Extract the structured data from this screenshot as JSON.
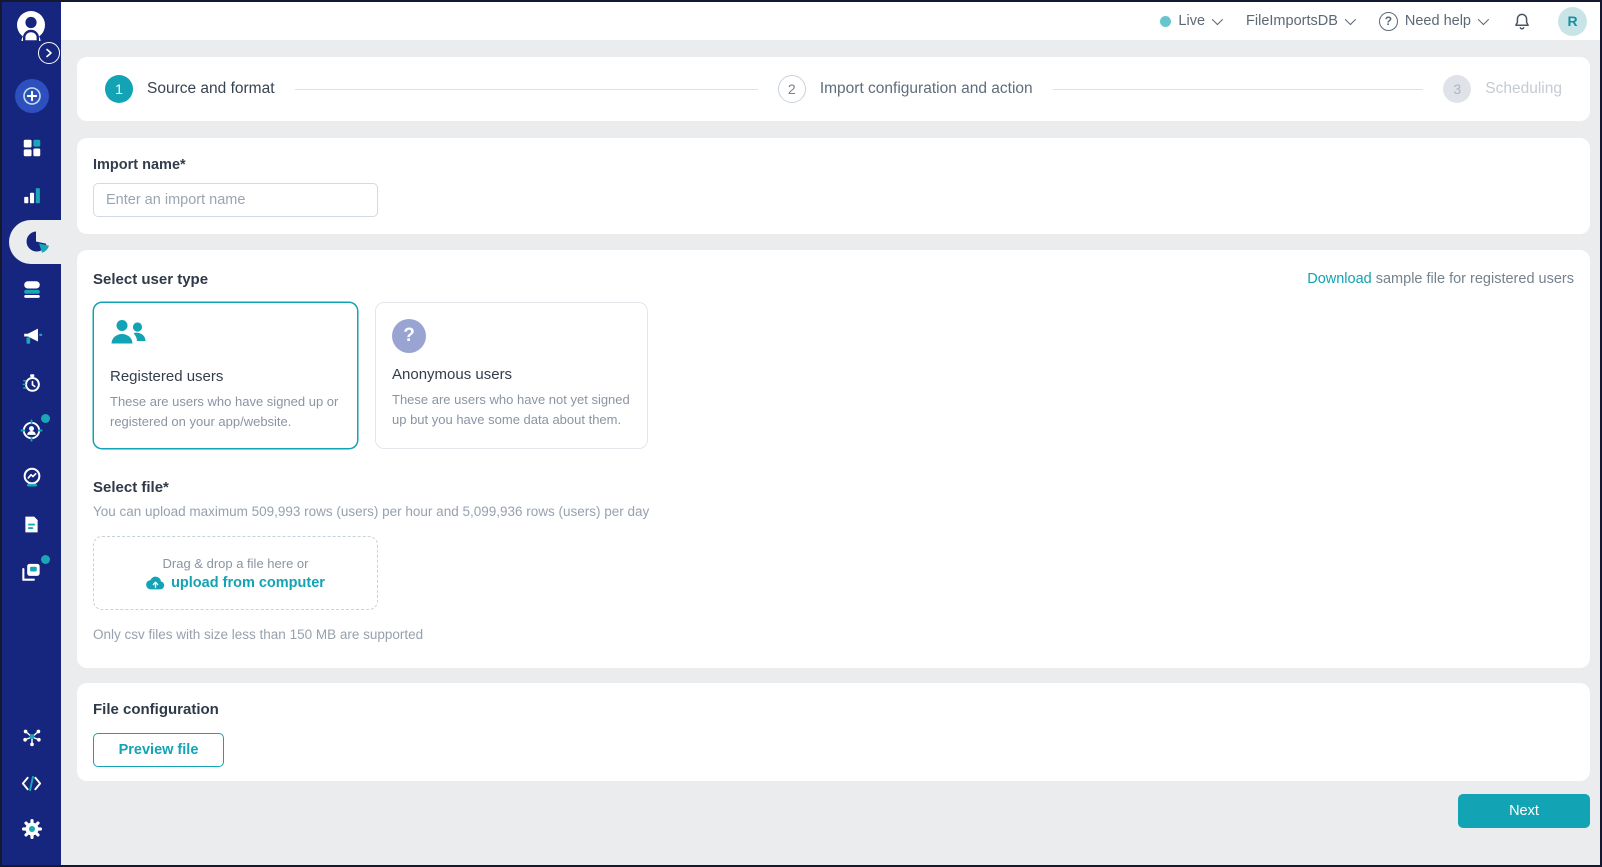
{
  "colors": {
    "accent_teal": "#12A3B4",
    "sidebar_navy": "#16267E",
    "page_background": "#EBECEE",
    "anonymous_icon_bg": "#99A4D2",
    "avatar_bg": "#C9E4E7"
  },
  "topbar": {
    "environment": {
      "label": "Live",
      "status_dot_color": "#66C6CE"
    },
    "project": {
      "label": "FileImportsDB"
    },
    "help": {
      "label": "Need help",
      "icon_glyph": "?"
    },
    "avatar": {
      "initial": "R"
    }
  },
  "stepper": {
    "steps": [
      {
        "number": "1",
        "label": "Source and format",
        "state": "active"
      },
      {
        "number": "2",
        "label": "Import configuration and action",
        "state": "upcoming"
      },
      {
        "number": "3",
        "label": "Scheduling",
        "state": "disabled"
      }
    ]
  },
  "sections": {
    "import_name": {
      "label": "Import name*",
      "input_placeholder": "Enter an import name"
    },
    "user_type": {
      "heading": "Select user type",
      "sample_file": {
        "link_text": "Download",
        "suffix_text": " sample file for registered users"
      },
      "options": [
        {
          "title": "Registered users",
          "description": "These are users who have signed up or registered on your app/website.",
          "selected": true
        },
        {
          "title": "Anonymous users",
          "description": "These are users who have not yet signed up but you have some data about them.",
          "selected": false,
          "icon_glyph": "?"
        }
      ]
    },
    "select_file": {
      "heading": "Select file*",
      "rate_limit_note": "You can upload maximum 509,993 rows (users) per hour and 5,099,936 rows (users) per day",
      "dropzone": {
        "line1": "Drag & drop a file here or",
        "upload_link": "upload from computer"
      },
      "format_note": "Only csv files with size less than 150 MB are supported"
    },
    "file_configuration": {
      "heading": "File configuration",
      "preview_button_label": "Preview file"
    }
  },
  "footer": {
    "next_button_label": "Next"
  }
}
